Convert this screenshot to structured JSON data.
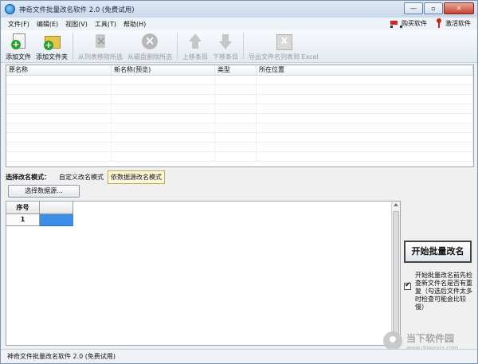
{
  "window": {
    "title": "神奇文件批量改名软件 2.0 (免费试用)",
    "controls": {
      "minimize": "—",
      "maximize": "▫",
      "close": "✕"
    }
  },
  "menu": {
    "items": [
      "文件(F)",
      "编辑(E)",
      "视图(V)",
      "工具(T)",
      "帮助(H)"
    ],
    "buy": "购买软件",
    "activate": "激活软件"
  },
  "toolbar": {
    "add_file": "添加文件",
    "add_folder": "添加文件夹",
    "remove_from_list": "从列表移除所选",
    "delete_from_disk": "从磁盘删除所选",
    "move_up": "上移条目",
    "move_down": "下移条目",
    "export_excel": "导出文件名列表到 Excel"
  },
  "file_list": {
    "columns": [
      "原名称",
      "新名称(预览)",
      "类型",
      "所在位置"
    ]
  },
  "mode": {
    "label": "选择改名模式：",
    "tabs": [
      "自定义改名模式",
      "依数据源改名模式"
    ],
    "active_index": 1
  },
  "data_source": {
    "select_button": "选择数据源...",
    "grid_header": "序号",
    "rows": [
      "1"
    ]
  },
  "actions": {
    "start_button": "开始批量改名",
    "check_duplicates_label": "开始批量改名前先检查新文件名是否有重复（勾选后文件太多时检查可能会比较慢）",
    "check_duplicates_checked": true
  },
  "statusbar": {
    "text": "神奇文件批量改名软件 2.0 (免费试用)"
  },
  "watermark": {
    "name": "当下软件园",
    "url": "www.downxia.com"
  }
}
